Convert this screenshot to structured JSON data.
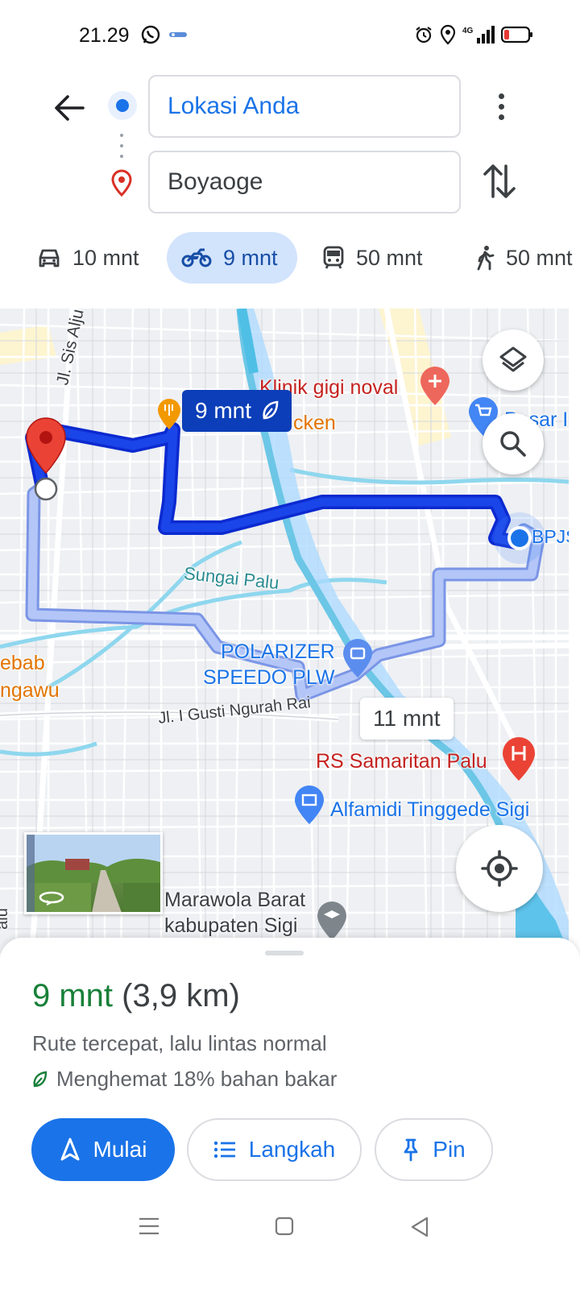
{
  "status_bar": {
    "time": "21.29",
    "left_icons": [
      "whatsapp-icon",
      "notification-icon"
    ],
    "right_icons": [
      "alarm-icon",
      "location-icon",
      "signal-4g-icon",
      "battery-icon"
    ],
    "network": "4G"
  },
  "header": {
    "origin": "Lokasi Anda",
    "destination": "Boyaoge"
  },
  "modes": [
    {
      "icon": "car-icon",
      "label": "10 mnt",
      "selected": false
    },
    {
      "icon": "motorcycle-icon",
      "label": "9 mnt",
      "selected": true
    },
    {
      "icon": "transit-icon",
      "label": "50 mnt",
      "selected": false
    },
    {
      "icon": "walk-icon",
      "label": "50 mnt",
      "selected": false
    }
  ],
  "map": {
    "labels": {
      "street_sis": "Jl. Sis Alju",
      "clinic": "Klinik gigi noval",
      "chicken": "cken",
      "pasar": "Pasar I",
      "bpjs": "BPJS",
      "river": "Sungai Palu",
      "polarizer_line1": "POLARIZER",
      "polarizer_line2": "SPEEDO PLW",
      "kebab_line1": "ebab",
      "kebab_line2": "ngawu",
      "street_gusti": "Jl. I Gusti Ngurah Rai",
      "hospital": "RS Samaritan Palu",
      "alfamidi": "Alfamidi Tinggede Sigi",
      "marawola_line1": "Marawola Barat",
      "marawola_line2": "kabupaten Sigi",
      "left_edge": "alu"
    },
    "primary_route_time": "9 mnt",
    "alt_route_time": "11 mnt",
    "route_color": "#1a45e8",
    "alt_route_color": "#9fb7f5"
  },
  "sheet": {
    "duration": "9 mnt",
    "distance": "(3,9 km)",
    "description": "Rute tercepat, lalu lintas normal",
    "fuel_saving": "Menghemat 18% bahan bakar",
    "buttons": {
      "start": "Mulai",
      "steps": "Langkah",
      "pin": "Pin"
    }
  },
  "colors": {
    "accent": "#1a73e8",
    "duration_green": "#188038",
    "selected_chip": "#d2e3fc",
    "pin_red": "#ea4335"
  }
}
